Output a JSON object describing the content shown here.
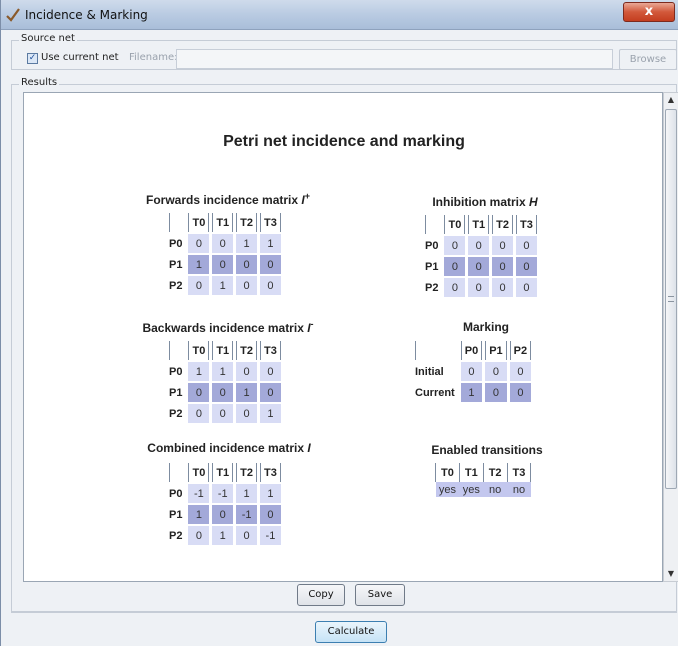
{
  "window": {
    "title": "Incidence & Marking",
    "close_label": "x"
  },
  "source": {
    "group_title": "Source net",
    "use_current_label": "Use current net",
    "use_current_checked": true,
    "filename_label": "Filename:",
    "filename_value": "",
    "browse_label": "Browse"
  },
  "results": {
    "group_title": "Results",
    "heading": "Petri net incidence and marking",
    "forwards": {
      "title": "Forwards incidence matrix ",
      "symbol": "I",
      "sup": "+",
      "columns": [
        "T0",
        "T1",
        "T2",
        "T3"
      ],
      "rows": [
        {
          "label": "P0",
          "values": [
            "0",
            "0",
            "1",
            "1"
          ]
        },
        {
          "label": "P1",
          "values": [
            "1",
            "0",
            "0",
            "0"
          ]
        },
        {
          "label": "P2",
          "values": [
            "0",
            "1",
            "0",
            "0"
          ]
        }
      ]
    },
    "backwards": {
      "title": "Backwards incidence matrix ",
      "symbol": "I",
      "sup": "-",
      "columns": [
        "T0",
        "T1",
        "T2",
        "T3"
      ],
      "rows": [
        {
          "label": "P0",
          "values": [
            "1",
            "1",
            "0",
            "0"
          ]
        },
        {
          "label": "P1",
          "values": [
            "0",
            "0",
            "1",
            "0"
          ]
        },
        {
          "label": "P2",
          "values": [
            "0",
            "0",
            "0",
            "1"
          ]
        }
      ]
    },
    "combined": {
      "title": "Combined incidence matrix ",
      "symbol": "I",
      "columns": [
        "T0",
        "T1",
        "T2",
        "T3"
      ],
      "rows": [
        {
          "label": "P0",
          "values": [
            "-1",
            "-1",
            "1",
            "1"
          ]
        },
        {
          "label": "P1",
          "values": [
            "1",
            "0",
            "-1",
            "0"
          ]
        },
        {
          "label": "P2",
          "values": [
            "0",
            "1",
            "0",
            "-1"
          ]
        }
      ]
    },
    "inhibition": {
      "title": "Inhibition matrix ",
      "symbol": "H",
      "columns": [
        "T0",
        "T1",
        "T2",
        "T3"
      ],
      "rows": [
        {
          "label": "P0",
          "values": [
            "0",
            "0",
            "0",
            "0"
          ]
        },
        {
          "label": "P1",
          "values": [
            "0",
            "0",
            "0",
            "0"
          ]
        },
        {
          "label": "P2",
          "values": [
            "0",
            "0",
            "0",
            "0"
          ]
        }
      ]
    },
    "marking": {
      "title": "Marking",
      "columns": [
        "P0",
        "P1",
        "P2"
      ],
      "rows": [
        {
          "label": "Initial",
          "values": [
            "0",
            "0",
            "0"
          ]
        },
        {
          "label": "Current",
          "values": [
            "1",
            "0",
            "0"
          ]
        }
      ]
    },
    "enabled": {
      "title": "Enabled transitions",
      "columns": [
        "T0",
        "T1",
        "T2",
        "T3"
      ],
      "values": [
        "yes",
        "yes",
        "no",
        "no"
      ]
    },
    "copy_label": "Copy",
    "save_label": "Save"
  },
  "calculate_label": "Calculate",
  "colors": {
    "row_light": "#d8dcf5",
    "row_dark": "#a3a9d9",
    "close_button": "#c43d1f"
  }
}
